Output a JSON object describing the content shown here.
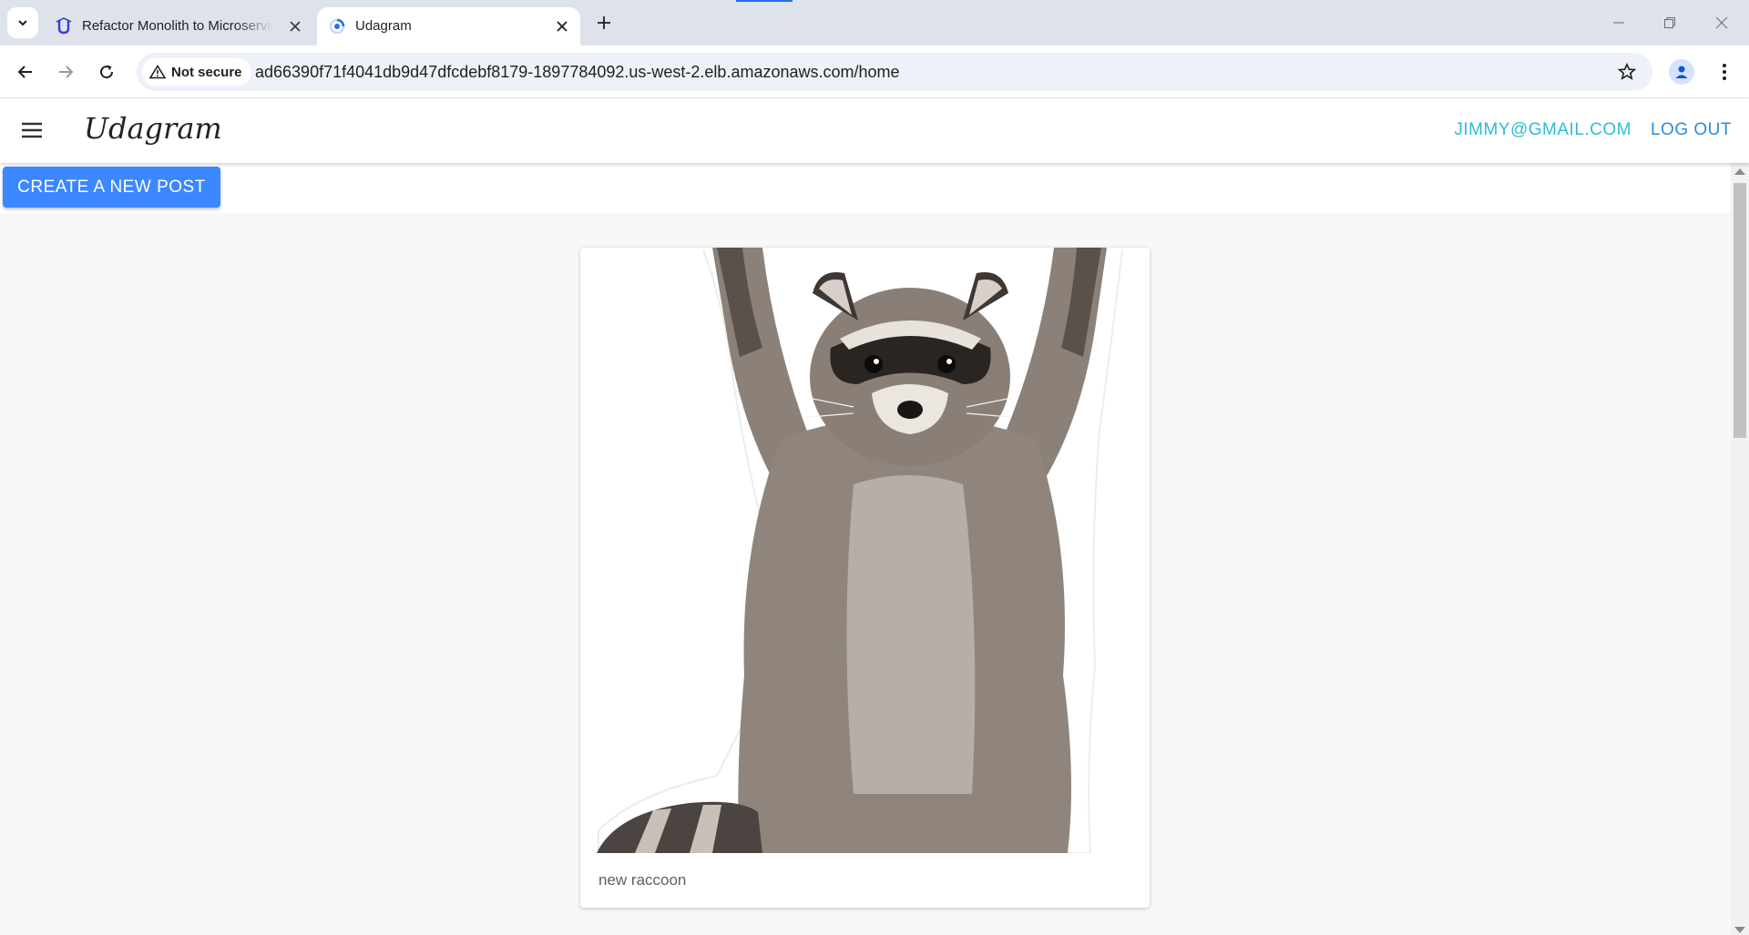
{
  "browser": {
    "tabs": [
      {
        "title": "Refactor Monolith to Microservices",
        "icon": "udacity-icon",
        "active": false
      },
      {
        "title": "Udagram",
        "icon": "loading-icon",
        "active": true
      }
    ],
    "security_label": "Not secure",
    "url": "ad66390f71f4041db9d47dfcdebf8179-1897784092.us-west-2.elb.amazonaws.com/home",
    "accent_color": "#1a73e8"
  },
  "app": {
    "brand": "Udagram",
    "user_email": "JIMMY@GMAIL.COM",
    "logout_label": "LOG OUT",
    "create_post_label": "CREATE A NEW POST",
    "colors": {
      "primary_button": "#3b87ff",
      "email_link": "#2ebcd6",
      "logout_link": "#2b8cd8"
    }
  },
  "feed": {
    "posts": [
      {
        "image_alt": "raccoon",
        "caption": "new raccoon"
      }
    ]
  }
}
